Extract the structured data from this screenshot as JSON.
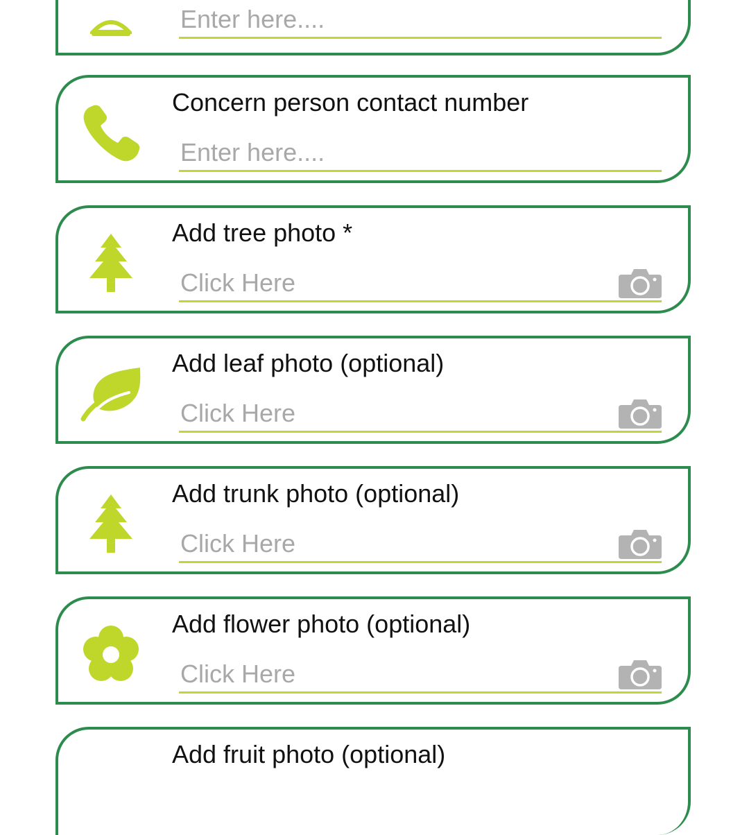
{
  "colors": {
    "card_border": "#2e8b4e",
    "accent": "#bfd62a",
    "underline": "#c2d530",
    "placeholder": "#a8a8a8",
    "camera": "#b3b3b3"
  },
  "cards": [
    {
      "title": "",
      "placeholder": "Enter here....",
      "icon": "person-icon",
      "camera": false
    },
    {
      "title": "Concern person contact number",
      "placeholder": "Enter here....",
      "icon": "phone-icon",
      "camera": false
    },
    {
      "title": "Add tree photo *",
      "placeholder": "Click Here",
      "icon": "tree-icon",
      "camera": true
    },
    {
      "title": "Add leaf photo (optional)",
      "placeholder": "Click Here",
      "icon": "leaf-icon",
      "camera": true
    },
    {
      "title": "Add trunk photo (optional)",
      "placeholder": "Click Here",
      "icon": "tree-icon",
      "camera": true
    },
    {
      "title": "Add flower photo (optional)",
      "placeholder": "Click Here",
      "icon": "flower-icon",
      "camera": true
    },
    {
      "title": "Add fruit photo (optional)",
      "placeholder": "",
      "icon": "fruit-icon",
      "camera": false
    }
  ]
}
